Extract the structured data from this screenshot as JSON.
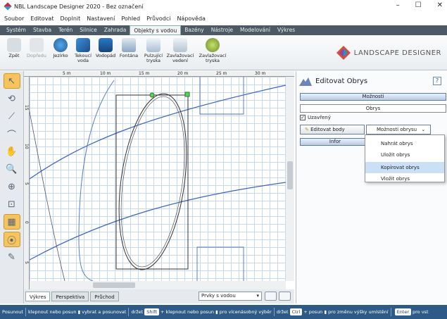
{
  "window": {
    "title": "NBL Landscape Designer 2020 - Bez označení",
    "min": "–",
    "max": "☐",
    "close": "✕"
  },
  "menu": [
    "Soubor",
    "Editovat",
    "Doplnit",
    "Nastavení",
    "Pohled",
    "Průvodci",
    "Nápověda"
  ],
  "ribbon_tabs": [
    "Systém",
    "Stavba",
    "Terén",
    "Silnice",
    "Zahrada",
    "Objekty s vodou",
    "Bazény",
    "Nástroje",
    "Modelování",
    "Výkres"
  ],
  "ribbon_active": "Objekty s vodou",
  "ribbon_buttons": {
    "undo": "Zpět",
    "redo": "Dopředu",
    "pond": "Jezírko",
    "stream_a": "Tekoucí",
    "stream_b": "voda",
    "waterfall": "Vodopád",
    "fountain": "Fontána",
    "pulse_a": "Pulzující",
    "pulse_b": "tryska",
    "irrig_a": "Zavlažovací",
    "irrig_b": "vedení",
    "irrigj_a": "Zavlažovací",
    "irrigj_b": "tryska"
  },
  "logo_text": "LANDSCAPE DESIGNER",
  "ruler": {
    "top": [
      "5 m",
      "10 m",
      "15 m",
      "20 m",
      "25 m",
      "30 m",
      "35 m"
    ],
    "left": [
      "15",
      "10",
      "5",
      "0",
      "5",
      "10"
    ]
  },
  "view_tabs": [
    "Výkres",
    "Perspektiva",
    "Průchod"
  ],
  "layer_select": "Prvky s vodou",
  "panel": {
    "title": "Editovat Obrys",
    "help": "?",
    "options_btn": "Možnosti",
    "tab": "Obrys",
    "closed_label": "Uzavřený",
    "closed_checked": true,
    "edit_points": "Editovat body",
    "outline_options": "Možnosti obrysu",
    "info_btn": "Infor"
  },
  "dropdown_menu": [
    {
      "label": "Nahrát obrys",
      "highlight": false
    },
    {
      "label": "Uložit obrys",
      "highlight": false
    },
    {
      "label": "Kopírovat obrys",
      "highlight": true
    },
    {
      "label": "Vložit obrys",
      "highlight": false
    }
  ],
  "status": {
    "s1": "Posunout",
    "s2": "klepnout nebo posun",
    "s3": "vybrat a posunovat",
    "s4": "držet",
    "k1": "Shift",
    "s5": "+ klepnout nebo posun",
    "s6": "pro vícenásobný výběr",
    "s7": "držet",
    "k2": "Ctrl",
    "s8": "+ posun",
    "s9": "pro změnu výšky umístění",
    "k3": "Enter",
    "s10": "pro vst"
  },
  "colors": {
    "accent": "#2d5a86",
    "selected_tool": "#f6c35c",
    "menu_highlight": "#cce0f5"
  }
}
